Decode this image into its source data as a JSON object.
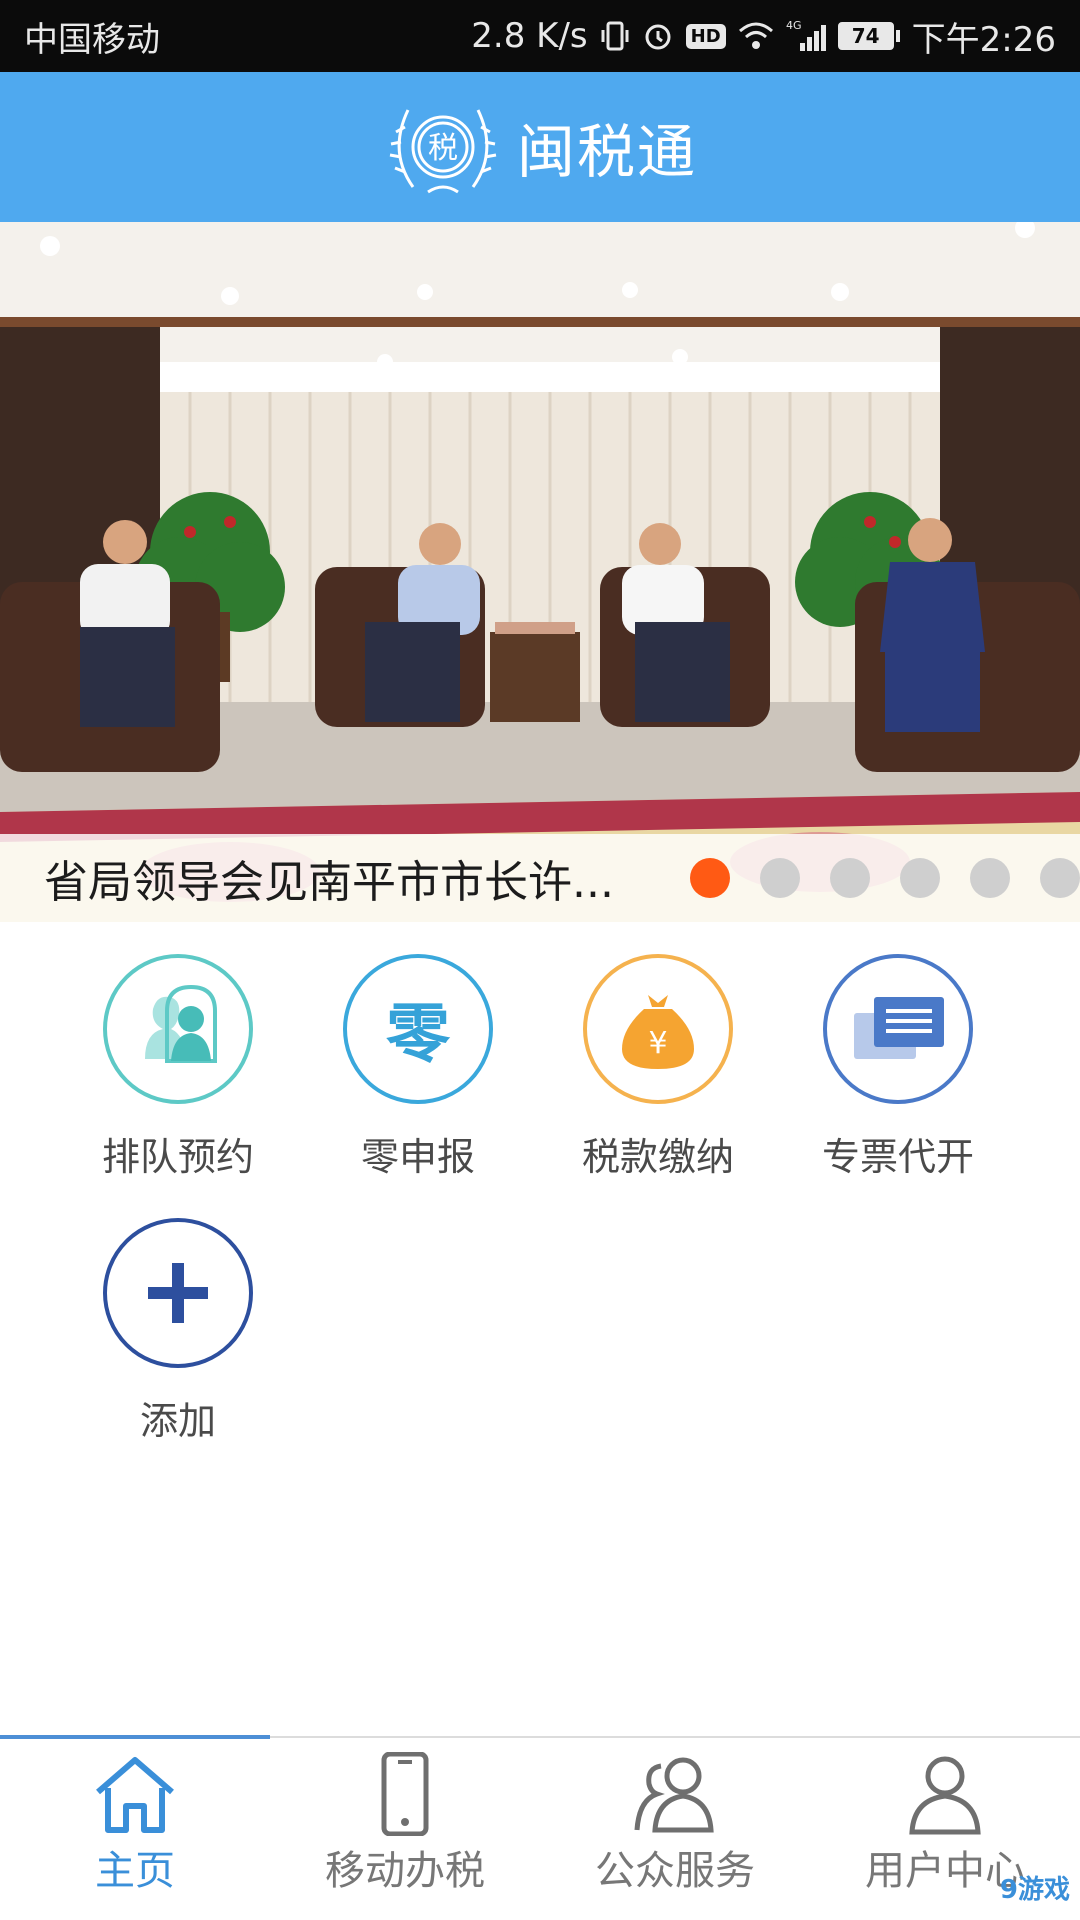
{
  "status_bar": {
    "carrier": "中国移动",
    "speed": "2.8 K/s",
    "hd": "HD",
    "network": "4G",
    "battery": "74",
    "time": "下午2:26"
  },
  "header": {
    "title": "闽税通",
    "logo_glyph": "税"
  },
  "banner": {
    "caption": "省局领导会见南平市市长许...",
    "dots": [
      {
        "active": true
      },
      {
        "active": false
      },
      {
        "active": false
      },
      {
        "active": false
      },
      {
        "active": false
      },
      {
        "active": false
      }
    ]
  },
  "shortcuts": [
    {
      "label": "排队预约",
      "icon": "queue-appointment-icon",
      "color": "#5dc9c6"
    },
    {
      "label": "零申报",
      "icon": "zero-declaration-icon",
      "color": "#3aa8dc",
      "glyph": "零"
    },
    {
      "label": "税款缴纳",
      "icon": "tax-payment-icon",
      "color": "#f5b24e",
      "glyph": "¥"
    },
    {
      "label": "专票代开",
      "icon": "invoice-issue-icon",
      "color": "#4a79c8"
    },
    {
      "label": "添加",
      "icon": "add-icon",
      "color": "#2d4f9e"
    }
  ],
  "bottom_nav": [
    {
      "label": "主页",
      "icon": "home-icon",
      "active": true
    },
    {
      "label": "移动办税",
      "icon": "mobile-phone-icon",
      "active": false
    },
    {
      "label": "公众服务",
      "icon": "people-icon",
      "active": false
    },
    {
      "label": "用户中心",
      "icon": "user-icon",
      "active": false
    }
  ],
  "watermark": "9游戏"
}
